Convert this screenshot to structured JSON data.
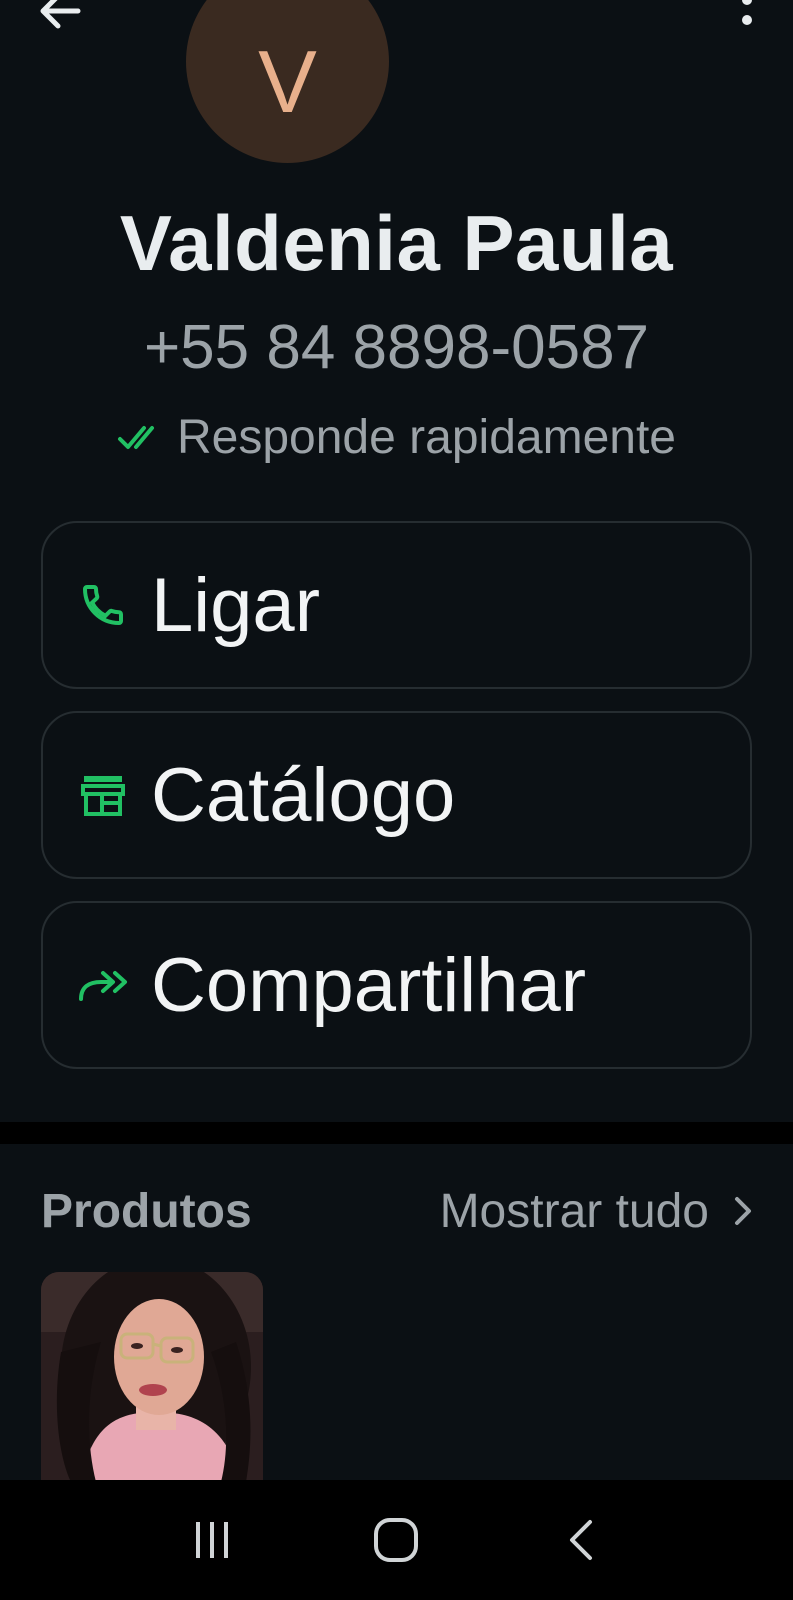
{
  "header": {
    "back_icon": "arrow-left-icon",
    "menu_icon": "more-vertical-icon"
  },
  "profile": {
    "avatar_initial": "V",
    "name": "Valdenia Paula",
    "phone": "+55 84 8898-0587",
    "status": "Responde rapidamente",
    "status_icon": "double-check-icon"
  },
  "actions": [
    {
      "label": "Ligar",
      "icon": "phone-icon"
    },
    {
      "label": "Catálogo",
      "icon": "storefront-icon"
    },
    {
      "label": "Compartilhar",
      "icon": "share-forward-icon"
    }
  ],
  "products": {
    "title": "Produtos",
    "show_all": "Mostrar tudo",
    "items": [
      {
        "image": "product-photo-woman-with-glasses"
      }
    ]
  },
  "colors": {
    "background": "#0b1014",
    "accent_green": "#21c063",
    "avatar_bg": "#3a2a20",
    "avatar_text": "#e8b08c",
    "muted_text": "#9ca3a8"
  },
  "nav": {
    "recent_icon": "recent-apps-icon",
    "home_icon": "home-icon",
    "back_icon": "nav-back-icon"
  }
}
